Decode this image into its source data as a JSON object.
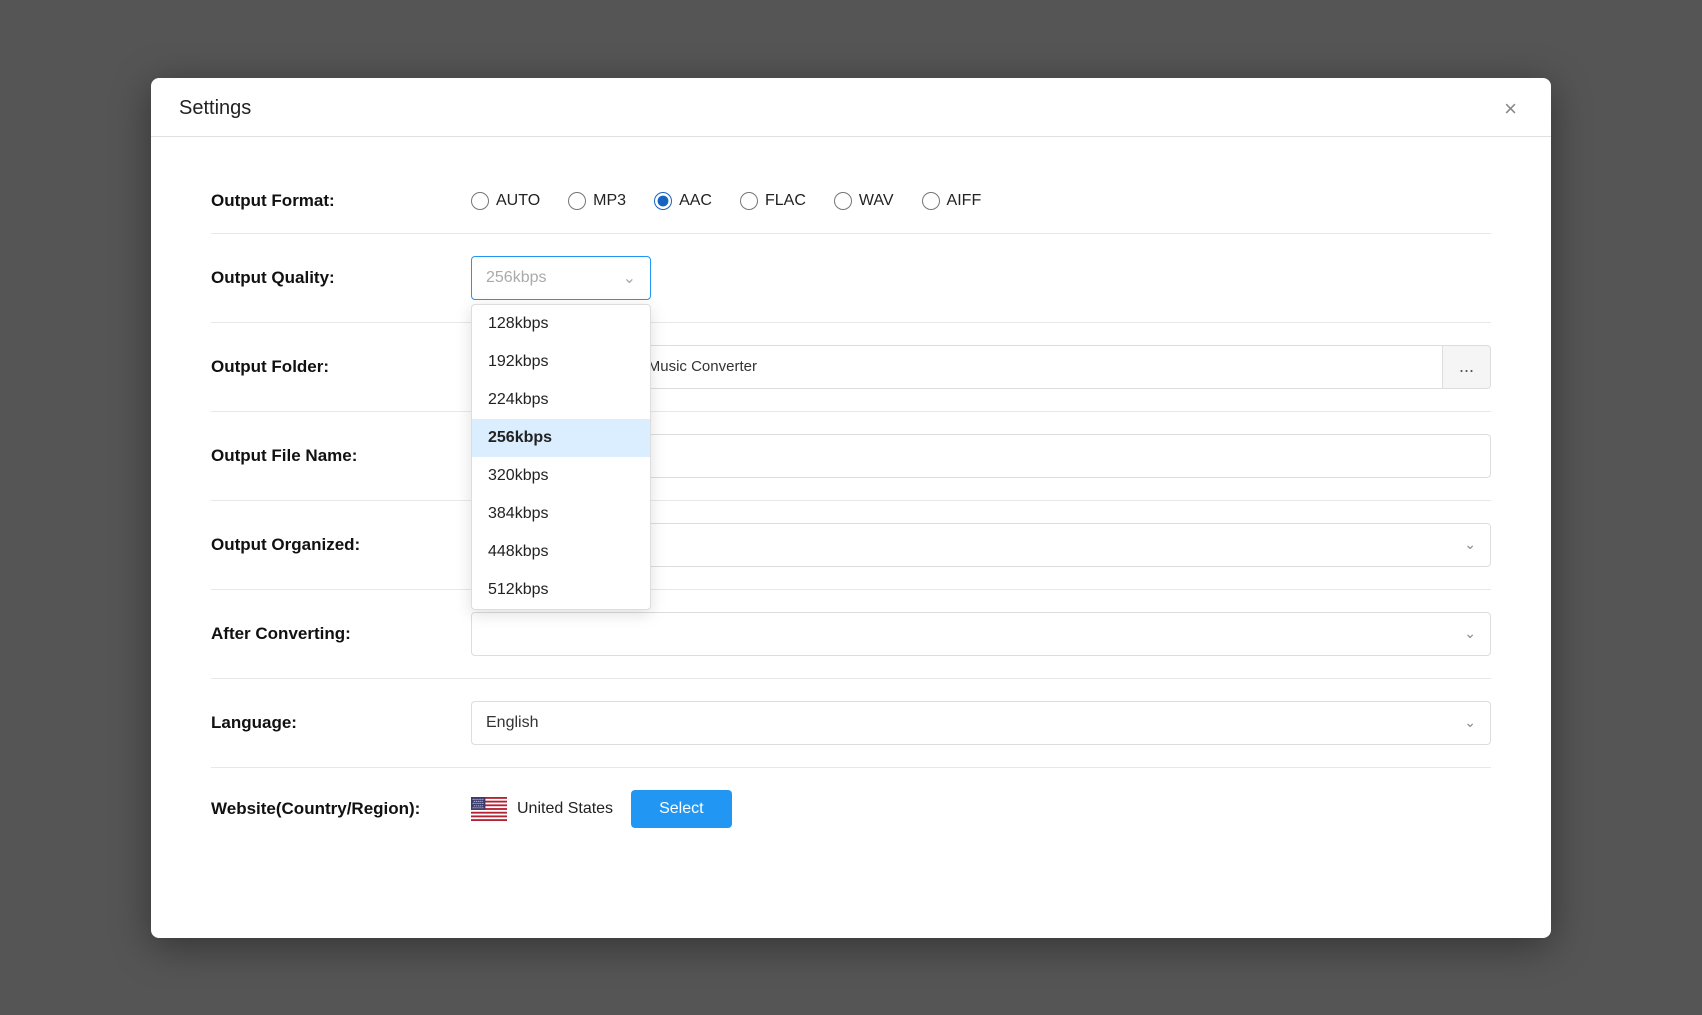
{
  "dialog": {
    "title": "Settings",
    "close_label": "×"
  },
  "output_format": {
    "label": "Output Format:",
    "options": [
      "AUTO",
      "MP3",
      "AAC",
      "FLAC",
      "WAV",
      "AIFF"
    ],
    "selected": "AAC"
  },
  "output_quality": {
    "label": "Output Quality:",
    "selected": "256kbps",
    "options": [
      "128kbps",
      "192kbps",
      "224kbps",
      "256kbps",
      "320kbps",
      "384kbps",
      "448kbps",
      "512kbps"
    ]
  },
  "output_folder": {
    "label": "Output Folder:",
    "value": "nents\\Ukeysoft Amazon Music Converter",
    "browse_label": "..."
  },
  "output_file_name": {
    "label": "Output File Name:",
    "value": ""
  },
  "output_organized": {
    "label": "Output Organized:",
    "value": ""
  },
  "after_converting": {
    "label": "After Converting:",
    "value": ""
  },
  "language": {
    "label": "Language:",
    "value": "English"
  },
  "website": {
    "label": "Website(Country/Region):",
    "country": "United States",
    "select_label": "Select"
  }
}
